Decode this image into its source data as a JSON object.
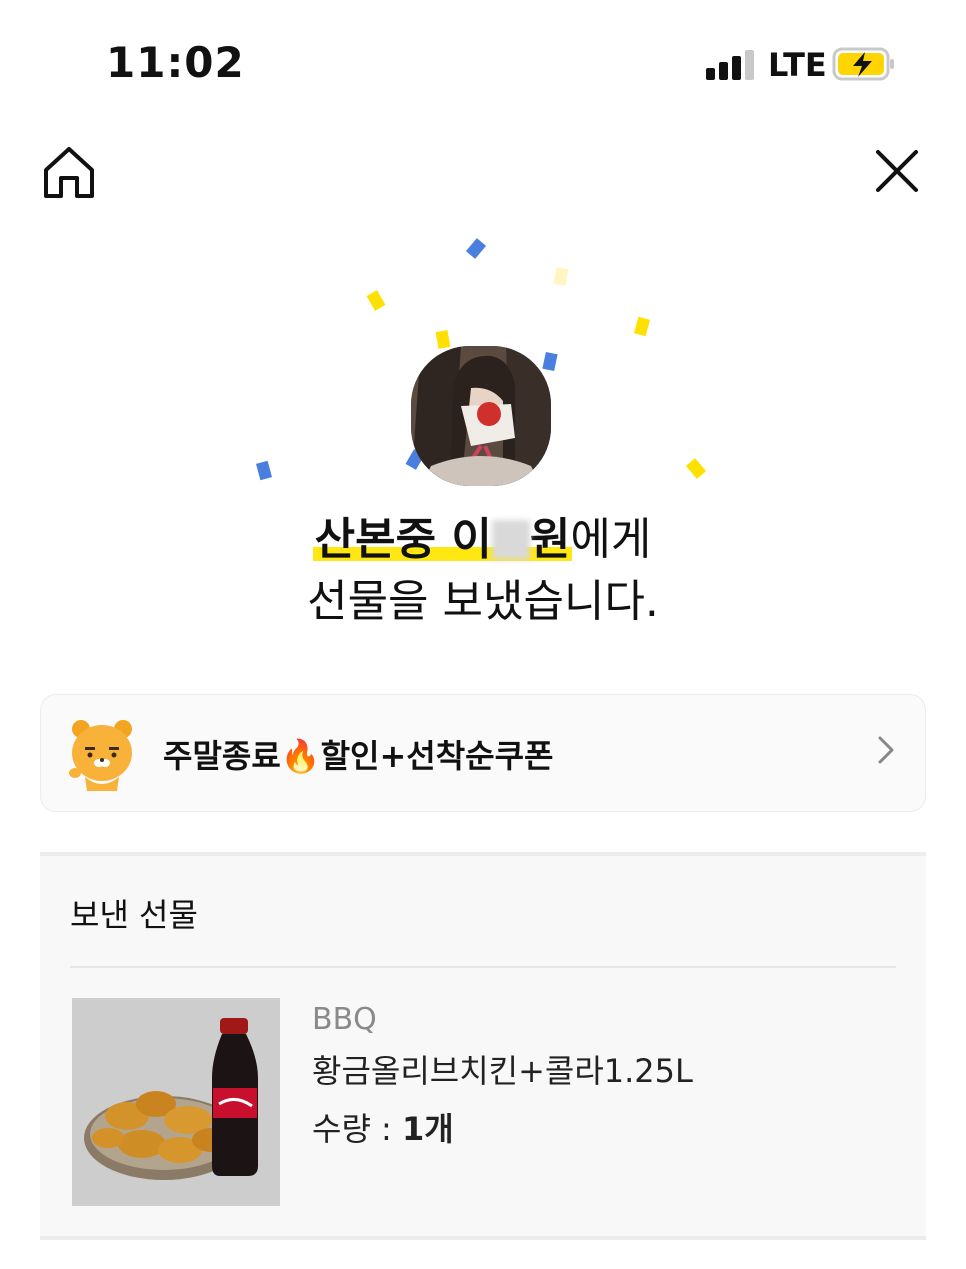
{
  "status_bar": {
    "time": "11:02",
    "network": "LTE",
    "signal_bars": 3,
    "battery_charging": true,
    "battery_color": "#ffd400"
  },
  "nav": {
    "home_icon": "home-icon",
    "close_icon": "close-icon"
  },
  "confetti_colors": {
    "blue": "#4a7fe0",
    "yellow": "#ffe000",
    "pale_yellow": "#fff6c2"
  },
  "recipient": {
    "name_part1": "산본중 이",
    "name_part2": "원",
    "suffix": "에게",
    "highlight_color": "#ffe812"
  },
  "message_line2": "선물을 보냈습니다.",
  "promo": {
    "mascot_icon": "ryan-mascot-icon",
    "text": "주말종료🔥할인+선착순쿠폰",
    "chevron_icon": "chevron-right-icon"
  },
  "gift": {
    "section_title": "보낸 선물",
    "brand": "BBQ",
    "product_name": "황금올리브치킨+콜라1.25L",
    "quantity_label": "수량 : ",
    "quantity_value": "1개"
  }
}
